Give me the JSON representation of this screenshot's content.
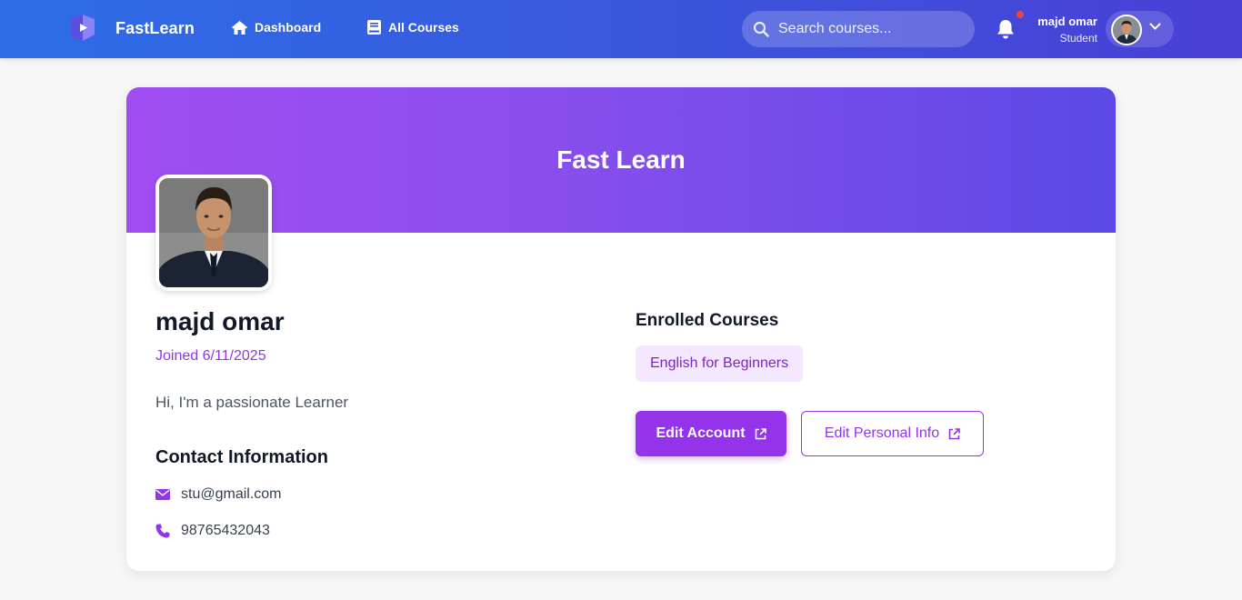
{
  "colors": {
    "brand_gradient_start": "#2d6ee8",
    "brand_gradient_end": "#4a3fd6",
    "accent": "#9333ea",
    "banner_start": "#a14ef1",
    "banner_end": "#5b49e6",
    "notification": "#ef4444"
  },
  "navbar": {
    "brand": "FastLearn",
    "logo_icon": "fastlearn-logo-icon",
    "links": [
      {
        "label": "Dashboard",
        "icon": "home-icon"
      },
      {
        "label": "All Courses",
        "icon": "book-icon"
      }
    ],
    "search": {
      "placeholder": "Search courses...",
      "value": ""
    },
    "notifications": {
      "has_unread": true
    },
    "user": {
      "name": "majd omar",
      "role": "Student"
    }
  },
  "profile": {
    "banner_title": "Fast Learn",
    "name": "majd omar",
    "joined": "Joined 6/11/2025",
    "bio": "Hi, I'm a passionate Learner",
    "contact": {
      "title": "Contact Information",
      "email": "stu@gmail.com",
      "phone": "98765432043"
    },
    "enrolled": {
      "title": "Enrolled Courses",
      "courses": [
        "English for Beginners"
      ]
    },
    "actions": {
      "edit_account": "Edit Account",
      "edit_personal": "Edit Personal Info"
    }
  }
}
